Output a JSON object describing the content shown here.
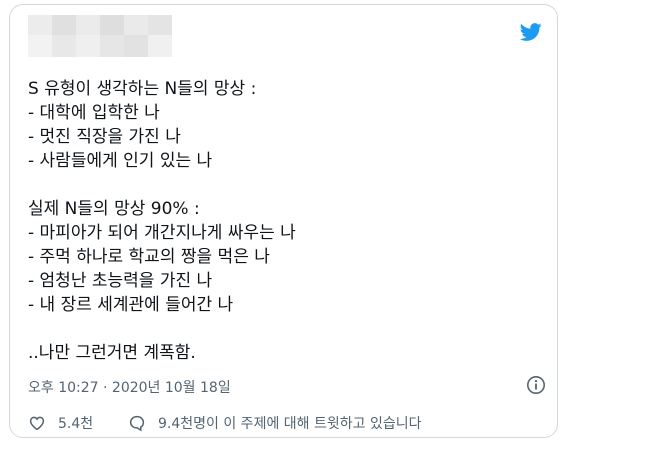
{
  "tweet": {
    "lines": [
      "S 유형이 생각하는 N들의 망상 :",
      "- 대학에 입학한 나",
      "- 멋진 직장을 가진 나",
      "- 사람들에게 인기 있는 나",
      "",
      "실제 N들의 망상 90% :",
      "- 마피아가 되어 개간지나게 싸우는 나",
      "- 주먹 하나로 학교의 짱을 먹은 나",
      "- 엄청난 초능력을 가진 나",
      "- 내 장르 세계관에 들어간 나",
      "",
      "..나만 그런거면 계폭함."
    ],
    "timestamp": "오후 10:27 · 2020년 10월 18일",
    "likes": "5.4천",
    "talking": "9.4천명이 이 주제에 대해 트윗하고 있습니다"
  },
  "icons": {
    "logo": "twitter-bird-icon",
    "info": "info-icon",
    "like": "heart-icon",
    "reply": "speech-bubble-icon"
  },
  "colors": {
    "brand": "#1d9bf0",
    "text": "#0f1419",
    "secondary": "#536471",
    "border": "#cfd9de"
  }
}
